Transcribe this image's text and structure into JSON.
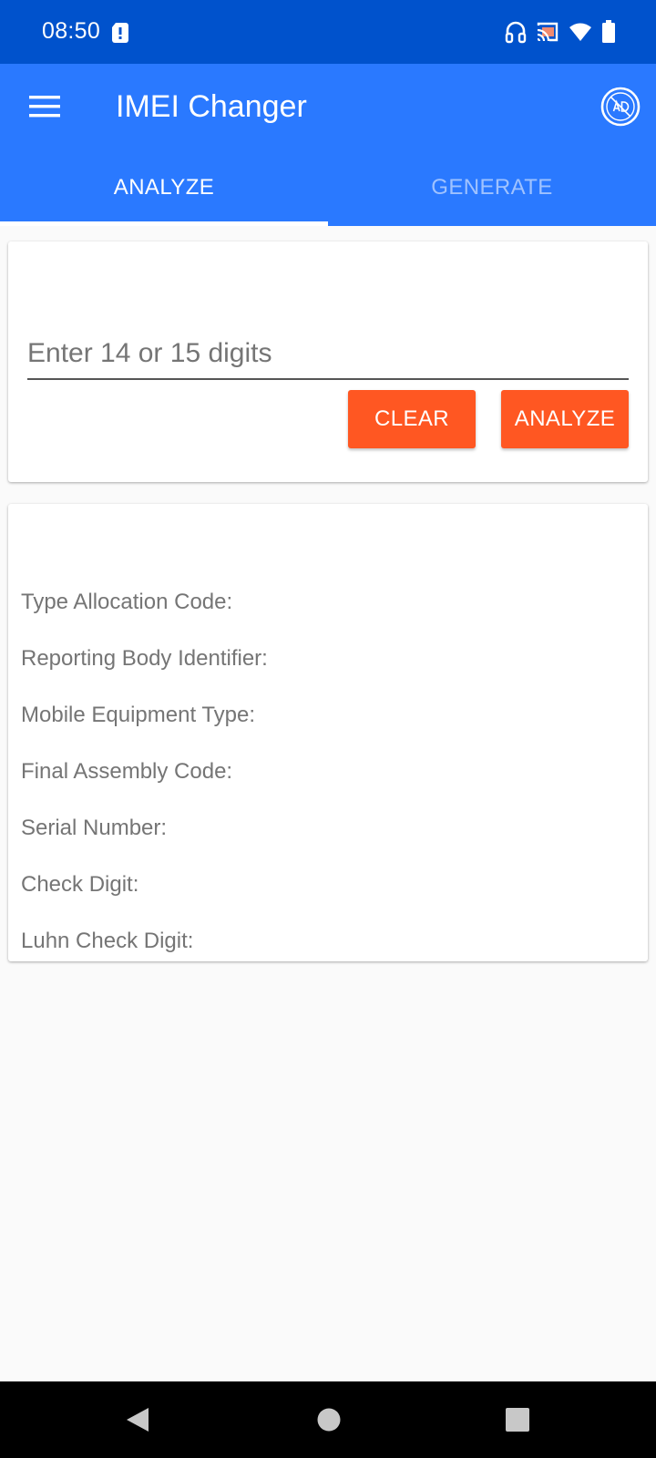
{
  "status_bar": {
    "time": "08:50",
    "icons": [
      "sim-alert-icon",
      "headphones-icon",
      "cast-icon",
      "wifi-icon",
      "battery-icon"
    ]
  },
  "app_bar": {
    "title": "IMEI Changer",
    "menu_icon": "hamburger-menu-icon",
    "no_ads_icon": "no-ads-icon",
    "background_color": "#2a79ff",
    "status_color": "#0052cc"
  },
  "tabs": [
    {
      "label": "ANALYZE",
      "active": true
    },
    {
      "label": "GENERATE",
      "active": false
    }
  ],
  "input_card": {
    "placeholder": "Enter 14 or 15 digits",
    "value": "",
    "clear_label": "CLEAR",
    "analyze_label": "ANALYZE",
    "button_color": "#ff5722"
  },
  "result_card": {
    "fields": [
      {
        "label": "Type Allocation Code:"
      },
      {
        "label": "Reporting Body Identifier:"
      },
      {
        "label": "Mobile Equipment Type:"
      },
      {
        "label": "Final Assembly Code:"
      },
      {
        "label": "Serial Number:"
      },
      {
        "label": "Check Digit:"
      },
      {
        "label": "Luhn Check Digit:"
      }
    ]
  },
  "nav_bar": {
    "icons": [
      "back-icon",
      "home-icon",
      "recents-icon"
    ]
  }
}
